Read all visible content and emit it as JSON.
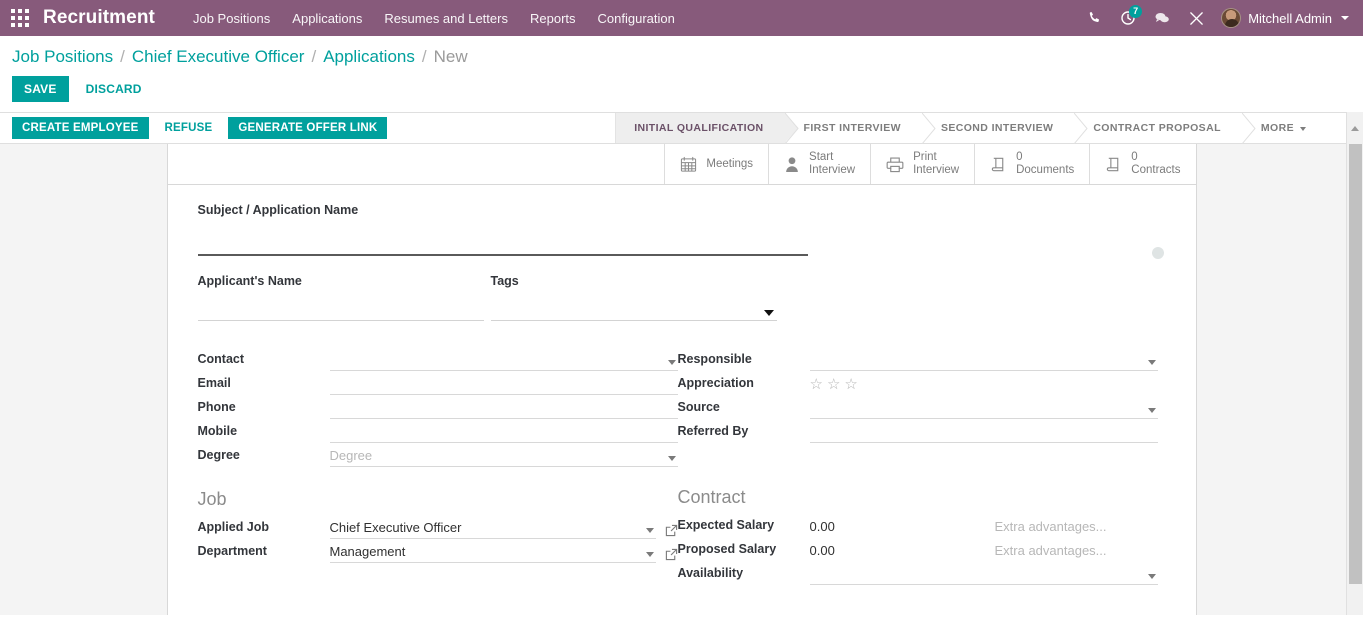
{
  "navbar": {
    "apps_icon": "apps-grid-icon",
    "brand": "Recruitment",
    "menu": [
      {
        "label": "Job Positions"
      },
      {
        "label": "Applications"
      },
      {
        "label": "Resumes and Letters"
      },
      {
        "label": "Reports"
      },
      {
        "label": "Configuration"
      }
    ],
    "sys_icons": [
      {
        "name": "phone-icon",
        "glyph": "phone"
      },
      {
        "name": "activity-clock-icon",
        "glyph": "clock",
        "badge": "7"
      },
      {
        "name": "messages-icon",
        "glyph": "chat"
      },
      {
        "name": "debug-tools-icon",
        "glyph": "wrench"
      }
    ],
    "user": {
      "name": "Mitchell Admin"
    },
    "brand_color": "#875A7B",
    "badge_color": "#00A09D"
  },
  "breadcrumb": [
    {
      "label": "Job Positions",
      "active": false
    },
    {
      "label": "Chief Executive Officer",
      "active": false
    },
    {
      "label": "Applications",
      "active": false
    },
    {
      "label": "New",
      "active": true
    }
  ],
  "control_buttons": {
    "save": "SAVE",
    "discard": "DISCARD"
  },
  "action_bar": {
    "buttons": [
      {
        "label": "CREATE EMPLOYEE",
        "style": "primary"
      },
      {
        "label": "REFUSE",
        "style": "plain"
      },
      {
        "label": "GENERATE OFFER LINK",
        "style": "primary"
      }
    ],
    "stages": [
      {
        "label": "INITIAL QUALIFICATION",
        "active": true
      },
      {
        "label": "FIRST INTERVIEW",
        "active": false
      },
      {
        "label": "SECOND INTERVIEW",
        "active": false
      },
      {
        "label": "CONTRACT PROPOSAL",
        "active": false
      },
      {
        "label": "MORE",
        "active": false,
        "dropdown": true
      }
    ],
    "primary_color": "#00A09D"
  },
  "stat_buttons": [
    {
      "icon": "calendar-icon",
      "count": "",
      "label": "Meetings"
    },
    {
      "icon": "person-icon",
      "count": "",
      "label": "Start\nInterview"
    },
    {
      "icon": "printer-icon",
      "count": "",
      "label": "Print\nInterview"
    },
    {
      "icon": "documents-icon",
      "count": "0",
      "label": "0\nDocuments"
    },
    {
      "icon": "contracts-icon",
      "count": "0",
      "label": "0\nContracts"
    }
  ],
  "form": {
    "title_label": "Subject / Application Name",
    "title_value": "",
    "title_placeholder": "",
    "applicant_name_label": "Applicant's Name",
    "applicant_name_value": "",
    "tags_label": "Tags",
    "tags_value": "",
    "kanban_state": "grey",
    "left_fields": [
      {
        "label": "Contact",
        "value": "",
        "placeholder": "",
        "dropdown": true
      },
      {
        "label": "Email",
        "value": "",
        "placeholder": "",
        "dropdown": false
      },
      {
        "label": "Phone",
        "value": "",
        "placeholder": "",
        "dropdown": false
      },
      {
        "label": "Mobile",
        "value": "",
        "placeholder": "",
        "dropdown": false
      },
      {
        "label": "Degree",
        "value": "",
        "placeholder": "Degree",
        "dropdown": true
      }
    ],
    "right_fields": [
      {
        "label": "Responsible",
        "value": "",
        "placeholder": "",
        "dropdown": true,
        "type": "text"
      },
      {
        "label": "Appreciation",
        "value": "",
        "placeholder": "",
        "dropdown": false,
        "type": "stars",
        "stars_filled": 0,
        "stars_total": 3
      },
      {
        "label": "Source",
        "value": "",
        "placeholder": "",
        "dropdown": true,
        "type": "text"
      },
      {
        "label": "Referred By",
        "value": "",
        "placeholder": "",
        "dropdown": false,
        "type": "text"
      }
    ],
    "job_group": {
      "title": "Job",
      "fields": [
        {
          "label": "Applied Job",
          "value": "Chief Executive Officer",
          "dropdown": true,
          "external": true
        },
        {
          "label": "Department",
          "value": "Management",
          "dropdown": true,
          "external": true
        }
      ]
    },
    "contract_group": {
      "title": "Contract",
      "fields": [
        {
          "label": "Expected Salary",
          "value": "0.00",
          "extra_value": "",
          "extra_placeholder": "Extra advantages...",
          "type": "salary"
        },
        {
          "label": "Proposed Salary",
          "value": "0.00",
          "extra_value": "",
          "extra_placeholder": "Extra advantages...",
          "type": "salary"
        },
        {
          "label": "Availability",
          "value": "",
          "dropdown": true,
          "type": "date"
        }
      ]
    }
  }
}
